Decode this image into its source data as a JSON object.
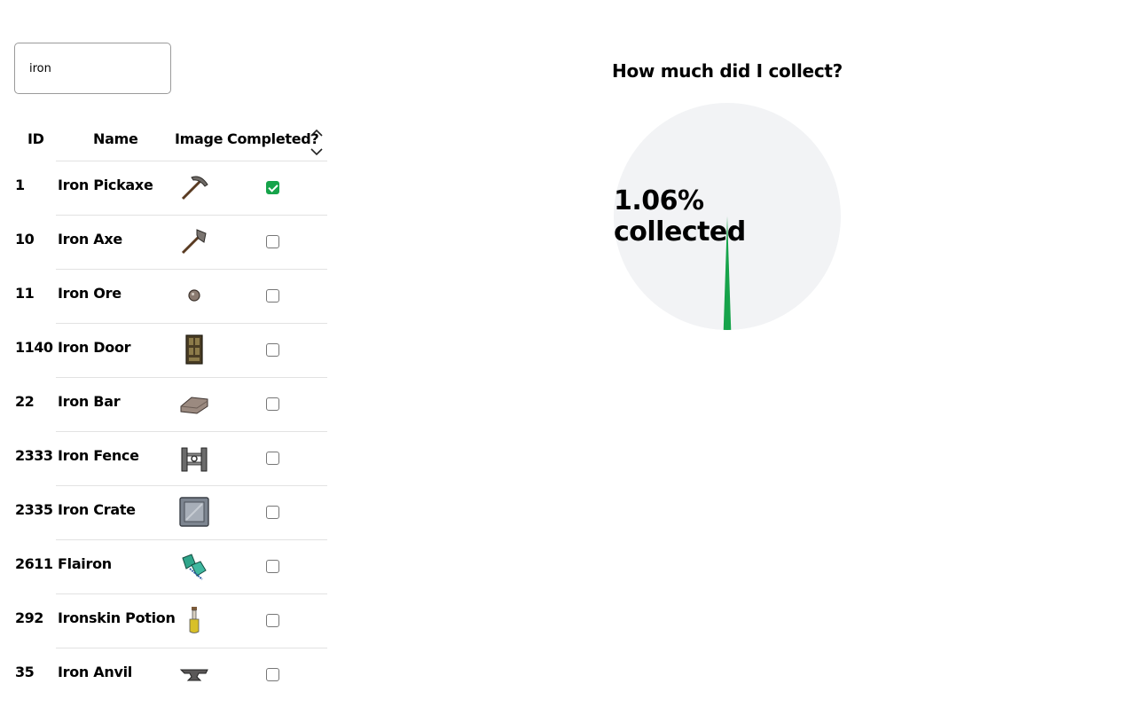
{
  "search": {
    "value": "iron"
  },
  "table": {
    "headers": {
      "id": "ID",
      "name": "Name",
      "image": "Image",
      "completed": "Completed?"
    },
    "rows": [
      {
        "id": "1",
        "name": "Iron Pickaxe",
        "icon": "pickaxe-icon",
        "completed": true
      },
      {
        "id": "10",
        "name": "Iron Axe",
        "icon": "axe-icon",
        "completed": false
      },
      {
        "id": "11",
        "name": "Iron Ore",
        "icon": "ore-icon",
        "completed": false
      },
      {
        "id": "1140",
        "name": "Iron Door",
        "icon": "door-icon",
        "completed": false
      },
      {
        "id": "22",
        "name": "Iron Bar",
        "icon": "bar-icon",
        "completed": false
      },
      {
        "id": "2333",
        "name": "Iron Fence",
        "icon": "fence-icon",
        "completed": false
      },
      {
        "id": "2335",
        "name": "Iron Crate",
        "icon": "crate-icon",
        "completed": false
      },
      {
        "id": "2611",
        "name": "Flairon",
        "icon": "flail-icon",
        "completed": false
      },
      {
        "id": "292",
        "name": "Ironskin Potion",
        "icon": "potion-icon",
        "completed": false
      },
      {
        "id": "35",
        "name": "Iron Anvil",
        "icon": "anvil-icon",
        "completed": false
      }
    ]
  },
  "chart": {
    "title": "How much did I collect?",
    "label": "1.06% collected",
    "collected_fraction": 0.0106,
    "colors": {
      "collected": "#16a34a",
      "remaining": "#f2f3f5"
    }
  }
}
